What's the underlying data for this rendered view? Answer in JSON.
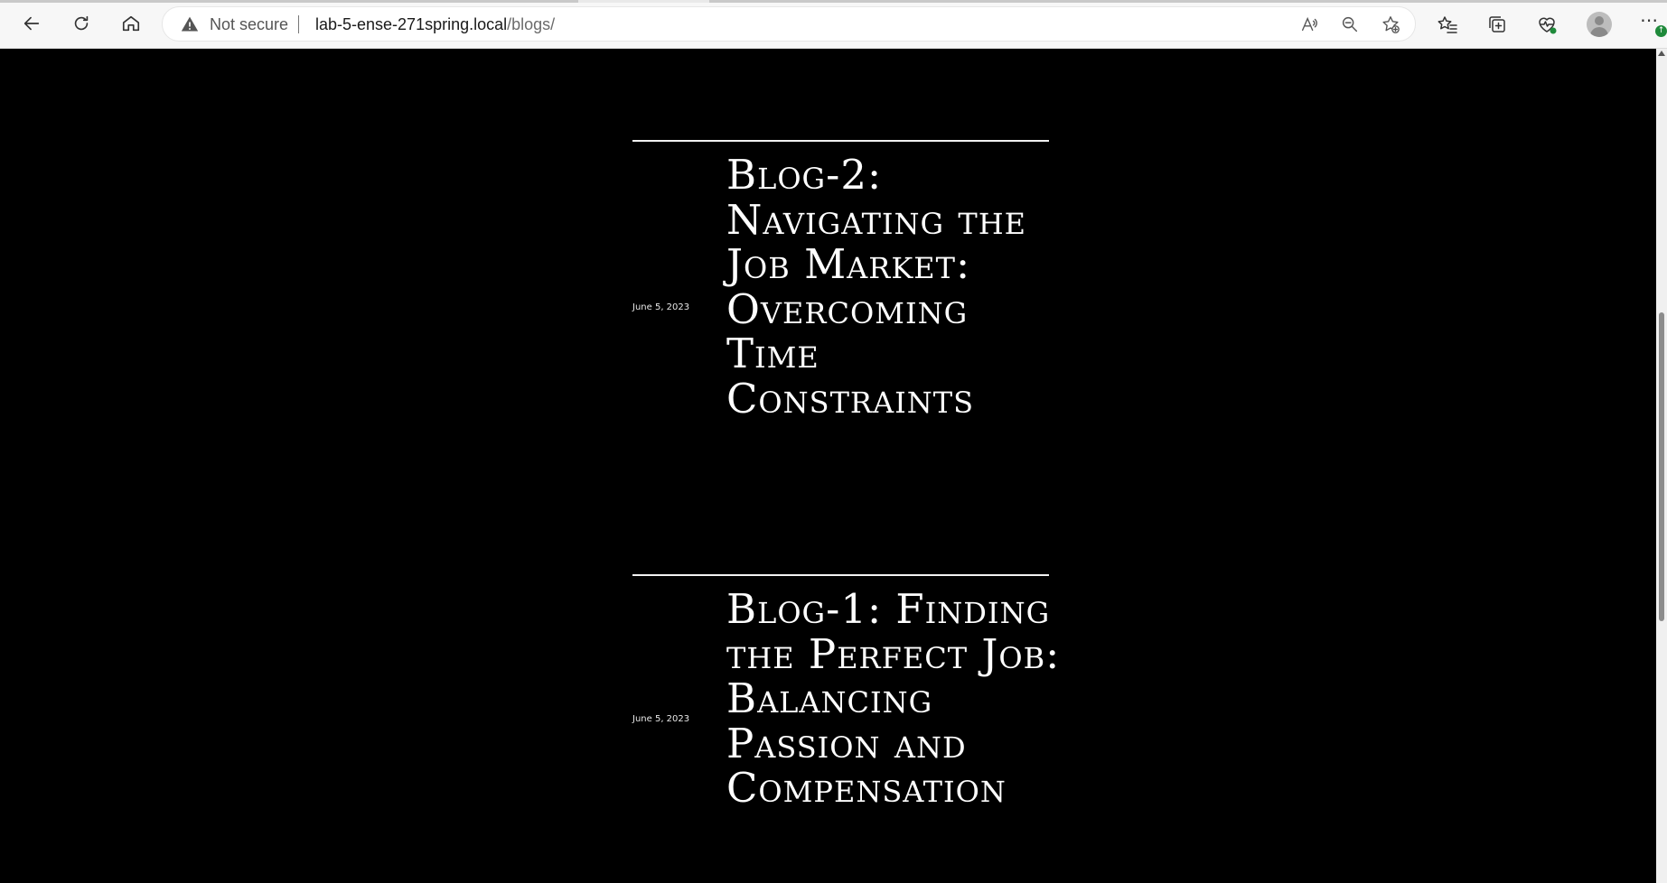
{
  "browser": {
    "security_label": "Not secure",
    "url_host": "lab-5-ense-271spring.local",
    "url_path": "/blogs/",
    "update_badge": "↑"
  },
  "posts": [
    {
      "date": "June 5, 2023",
      "title": "Blog-2: Navigating the Job Market: Overcoming Time Constraints"
    },
    {
      "date": "June 5, 2023",
      "title": "Blog-1: Finding the Perfect Job: Balancing Passion and Compensation"
    }
  ],
  "colors": {
    "page_background": "#000000",
    "text": "#ffffff",
    "security_indicator": "#555555",
    "update_badge": "#1f8a3b"
  }
}
